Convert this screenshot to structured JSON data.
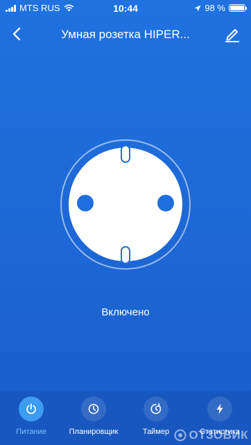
{
  "status_bar": {
    "carrier": "MTS RUS",
    "time": "10:44",
    "battery_text": "98 %",
    "battery_level": 0.98
  },
  "header": {
    "title": "Умная розетка HIPER...",
    "back_icon": "chevron-left-icon",
    "edit_icon": "pencil-icon"
  },
  "device": {
    "state_label": "Включено",
    "accent_color": "#1f72e0"
  },
  "tabs": [
    {
      "label": "Питание",
      "icon": "power-icon",
      "active": true
    },
    {
      "label": "Планировщик",
      "icon": "clock-icon",
      "active": false
    },
    {
      "label": "Таймер",
      "icon": "timer-icon",
      "active": false
    },
    {
      "label": "Статистика",
      "icon": "lightning-icon",
      "active": false
    }
  ],
  "watermark": "ОТЗОВИК"
}
